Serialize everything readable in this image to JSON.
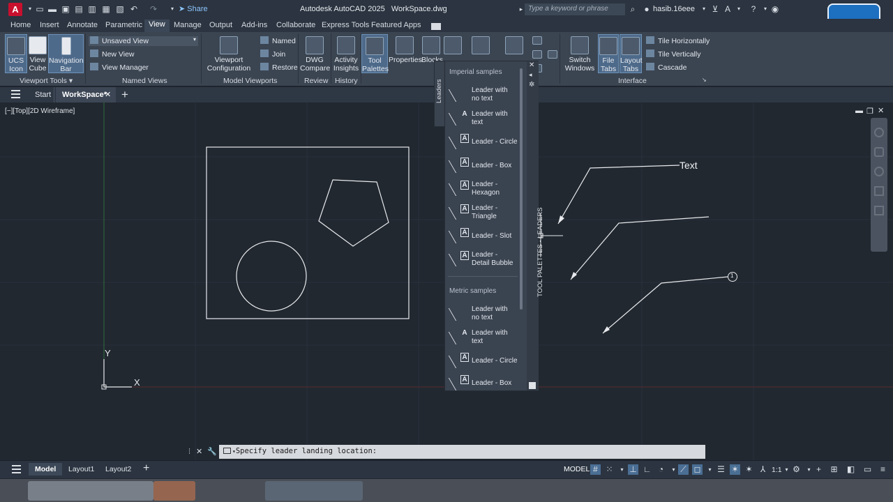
{
  "app": {
    "logo_letter": "A",
    "title": "Autodesk AutoCAD 2025",
    "file": "WorkSpace.dwg",
    "share_label": "Share",
    "search_placeholder": "Type a keyword or phrase",
    "user": "hasib.16eee"
  },
  "ribbon_tabs": [
    "Home",
    "Insert",
    "Annotate",
    "Parametric",
    "View",
    "Manage",
    "Output",
    "Add-ins",
    "Collaborate",
    "Express Tools",
    "Featured Apps"
  ],
  "active_ribbon_tab": "View",
  "ribbon": {
    "viewport_tools": {
      "title": "Viewport Tools",
      "buttons": [
        {
          "line1": "UCS",
          "line2": "Icon"
        },
        {
          "line1": "View",
          "line2": "Cube"
        },
        {
          "line1": "Navigation",
          "line2": "Bar"
        }
      ]
    },
    "named_views": {
      "title": "Named Views",
      "dropdown": "Unsaved View",
      "new_view": "New View",
      "view_manager": "View Manager"
    },
    "model_viewports": {
      "title": "Model Viewports",
      "config_line1": "Viewport",
      "config_line2": "Configuration",
      "named": "Named",
      "join": "Join",
      "restore": "Restore"
    },
    "review": {
      "title": "Review",
      "line1": "DWG",
      "line2": "Compare"
    },
    "history": {
      "title": "History",
      "line1": "Activity",
      "line2": "Insights"
    },
    "palettes": {
      "tool_line1": "Tool",
      "tool_line2": "Palettes",
      "properties": "Properties",
      "blocks": "Blocks"
    },
    "interface": {
      "title": "Interface",
      "switch_line1": "Switch",
      "switch_line2": "Windows",
      "file_line1": "File",
      "file_line2": "Tabs",
      "layout_line1": "Layout",
      "layout_line2": "Tabs",
      "tile_h": "Tile Horizontally",
      "tile_v": "Tile Vertically",
      "cascade": "Cascade"
    }
  },
  "file_tabs": {
    "start": "Start",
    "active": "WorkSpace*"
  },
  "viewport_label": "[−][Top][2D Wireframe]",
  "drawing": {
    "leader_text": "Text",
    "bubble_number": "1",
    "ucs_x": "X",
    "ucs_y": "Y"
  },
  "tool_palette": {
    "side_tab": "Leaders",
    "vertical_title": "TOOL PALETTES - LEADERS",
    "imperial_title": "Imperial samples",
    "imperial_items": [
      {
        "line1": "Leader with",
        "line2": "no text"
      },
      {
        "line1": "Leader with",
        "line2": "text"
      },
      {
        "line1": "Leader - Circle",
        "line2": ""
      },
      {
        "line1": "Leader - Box",
        "line2": ""
      },
      {
        "line1": "Leader -",
        "line2": "Hexagon"
      },
      {
        "line1": "Leader -",
        "line2": "Triangle"
      },
      {
        "line1": "Leader - Slot",
        "line2": ""
      },
      {
        "line1": "Leader -",
        "line2": "Detail Bubble"
      }
    ],
    "metric_title": "Metric samples",
    "metric_items": [
      {
        "line1": "Leader with",
        "line2": "no text"
      },
      {
        "line1": "Leader with",
        "line2": "text"
      },
      {
        "line1": "Leader - Circle",
        "line2": ""
      },
      {
        "line1": "Leader - Box",
        "line2": ""
      }
    ]
  },
  "command_line": {
    "prompt": "Specify leader landing location:"
  },
  "status_bar": {
    "model_tab": "Model",
    "layout1": "Layout1",
    "layout2": "Layout2",
    "model_button": "MODEL",
    "scale": "1:1"
  },
  "colors": {
    "background": "#212830",
    "ribbon": "#3b4552",
    "accent": "#4a6e94",
    "logo": "#c8102e"
  }
}
